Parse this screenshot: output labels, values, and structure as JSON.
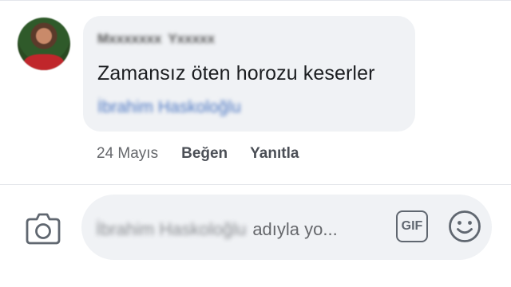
{
  "comment": {
    "author_first": "Mxxxxxxx",
    "author_last": "Yxxxxx",
    "text": "Zamansız öten horozu keserler",
    "mention": "İbrahim Haskoloğlu",
    "date": "24 Mayıs",
    "like_label": "Beğen",
    "reply_label": "Yanıtla"
  },
  "composer": {
    "placeholder_name": "İbrahim Haskoloğlu",
    "placeholder_suffix": "adıyla yo...",
    "gif_label": "GIF"
  },
  "icons": {
    "camera": "camera-icon",
    "gif": "gif-icon",
    "emoji": "smiley-icon"
  },
  "colors": {
    "bubble": "#f0f2f5",
    "mention": "#4b76c2",
    "muted": "#65676b",
    "icon": "#606770"
  }
}
